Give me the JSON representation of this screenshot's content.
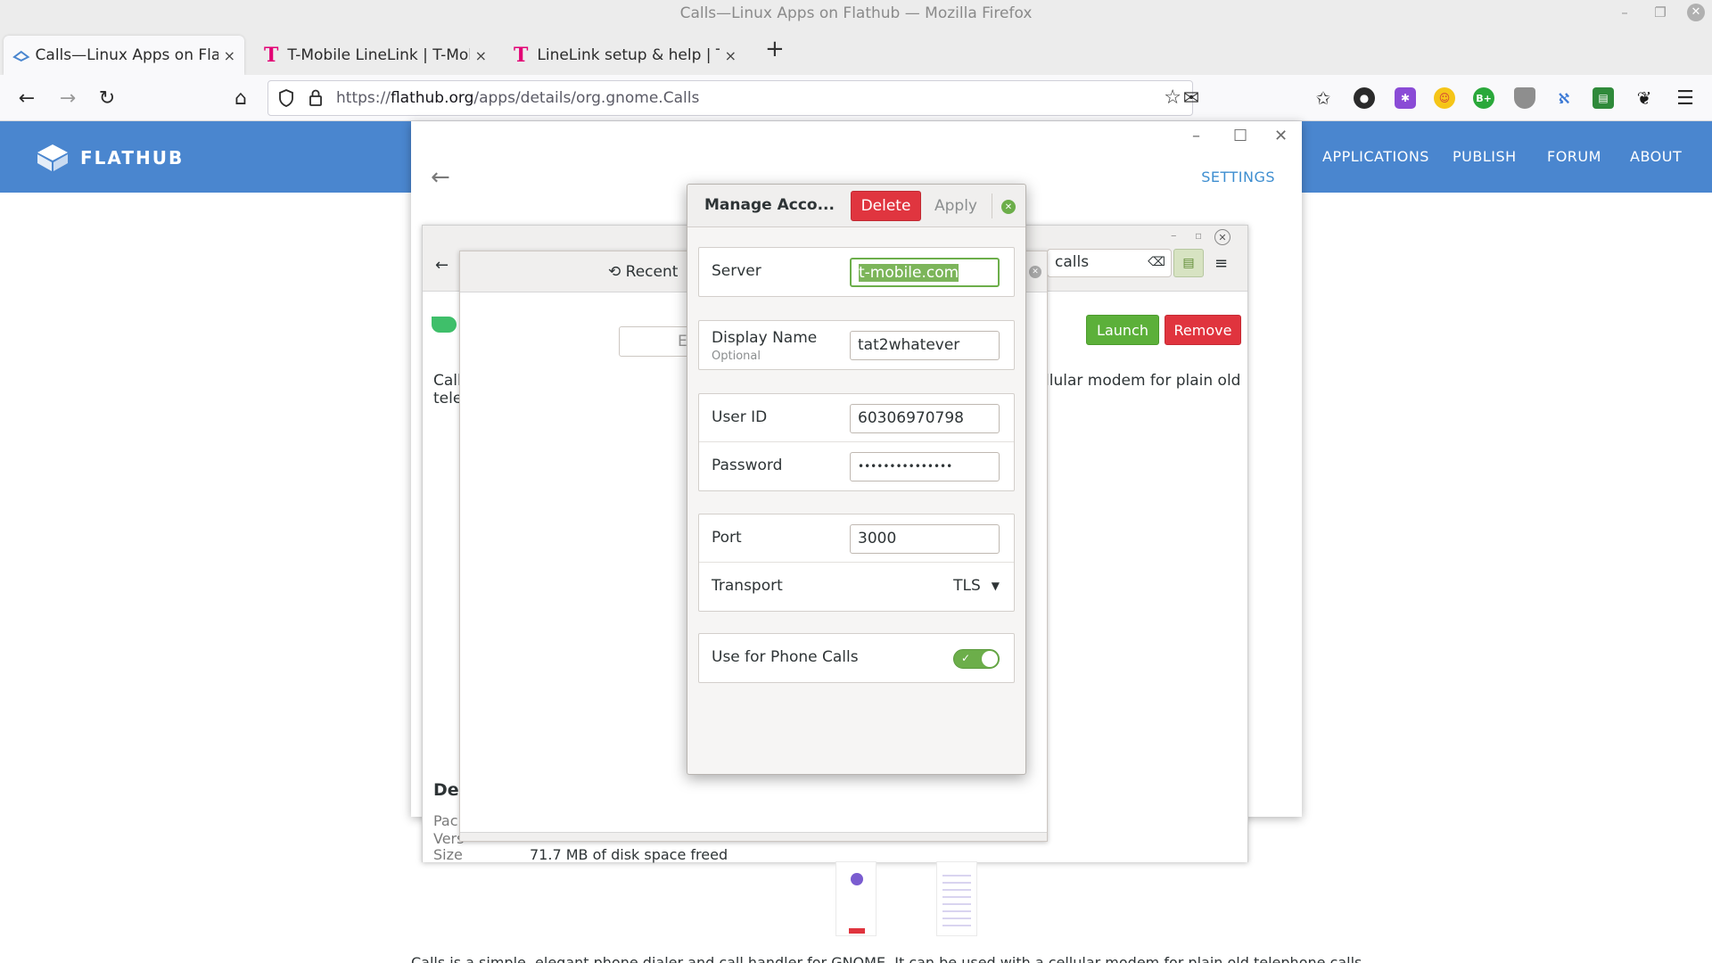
{
  "window": {
    "title": "Calls—Linux Apps on Flathub — Mozilla Firefox"
  },
  "tabs": [
    {
      "title": "Calls—Linux Apps on Flathu",
      "active": true
    },
    {
      "title": "T-Mobile LineLink | T-Mobile",
      "active": false
    },
    {
      "title": "LineLink setup & help | T-Mo",
      "active": false
    }
  ],
  "tab_close_glyph": "×",
  "new_tab_glyph": "+",
  "urlbar": {
    "scheme": "https://",
    "host": "flathub.org",
    "path": "/apps/details/org.gnome.Calls"
  },
  "flathub": {
    "logo_text": "FLATHUB",
    "nav": [
      "APPLICATIONS",
      "PUBLISH",
      "FORUM",
      "ABOUT"
    ],
    "settings": "SETTINGS"
  },
  "software": {
    "search_value": "calls",
    "launch": "Launch",
    "remove": "Remove",
    "desc_left_1": "Call",
    "desc_left_2": "tele",
    "desc_right_1": "llular modem for plain old",
    "details_title": "De",
    "detail_labels": [
      "Pac",
      "Vers",
      "Size"
    ],
    "size_value": "71.7 MB of disk space freed",
    "bottom_text": "Calls is a simple, elegant phone dialer and call handler for GNOME. It can be used with a cellular modem for plain old telephone calls"
  },
  "calls": {
    "recent_tab": "Recent",
    "dial_placeholder": "E"
  },
  "dialog": {
    "title": "Manage Acco...",
    "delete": "Delete",
    "apply": "Apply",
    "server_label": "Server",
    "server_value": "t-mobile.com",
    "display_name_label": "Display Name",
    "display_name_sub": "Optional",
    "display_name_value": "tat2whatever",
    "user_id_label": "User ID",
    "user_id_value": "60306970798",
    "password_label": "Password",
    "password_value": "•••••••••••••••",
    "port_label": "Port",
    "port_value": "3000",
    "transport_label": "Transport",
    "transport_value": "TLS",
    "phone_calls_label": "Use for Phone Calls",
    "phone_calls_enabled": true
  },
  "colors": {
    "flathub_blue": "#4a86cf",
    "delete_red": "#e0353f",
    "accent_green": "#6cae4a",
    "tmobile_magenta": "#e20074"
  }
}
